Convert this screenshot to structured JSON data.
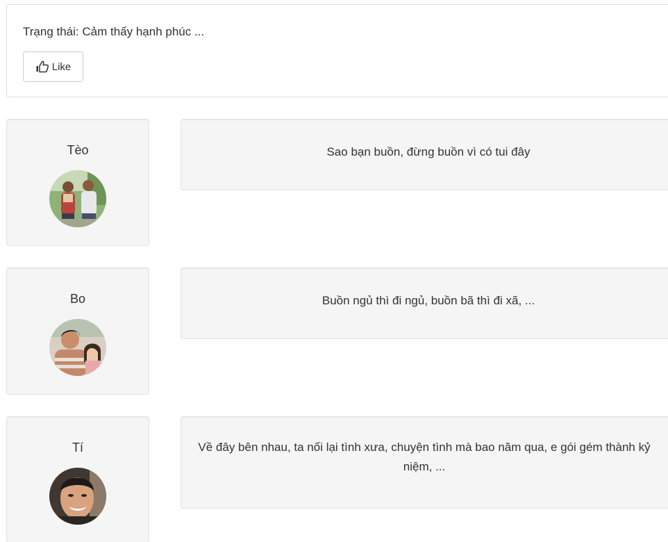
{
  "status": {
    "text": "Trạng thái: Cảm thấy hạnh phúc ...",
    "like_label": "Like",
    "like_icon": "thumbs-up-icon"
  },
  "comments": [
    {
      "name": "Tèo",
      "avatar": "avatar-photo",
      "message": "Sao bạn buồn, đừng buồn vì có tui đây"
    },
    {
      "name": "Bo",
      "avatar": "avatar-photo",
      "message": "Buồn ngủ thì đi ngủ, buồn bã thì đi xã, ..."
    },
    {
      "name": "Tí",
      "avatar": "avatar-photo",
      "message": "Về đây bên nhau, ta nối lại tình xưa, chuyện tình mà bao năm qua, e gói gém thành kỷ niệm, ..."
    }
  ],
  "colors": {
    "card_background": "#f5f5f5",
    "card_border": "#e3e3e3",
    "text": "#333333"
  }
}
